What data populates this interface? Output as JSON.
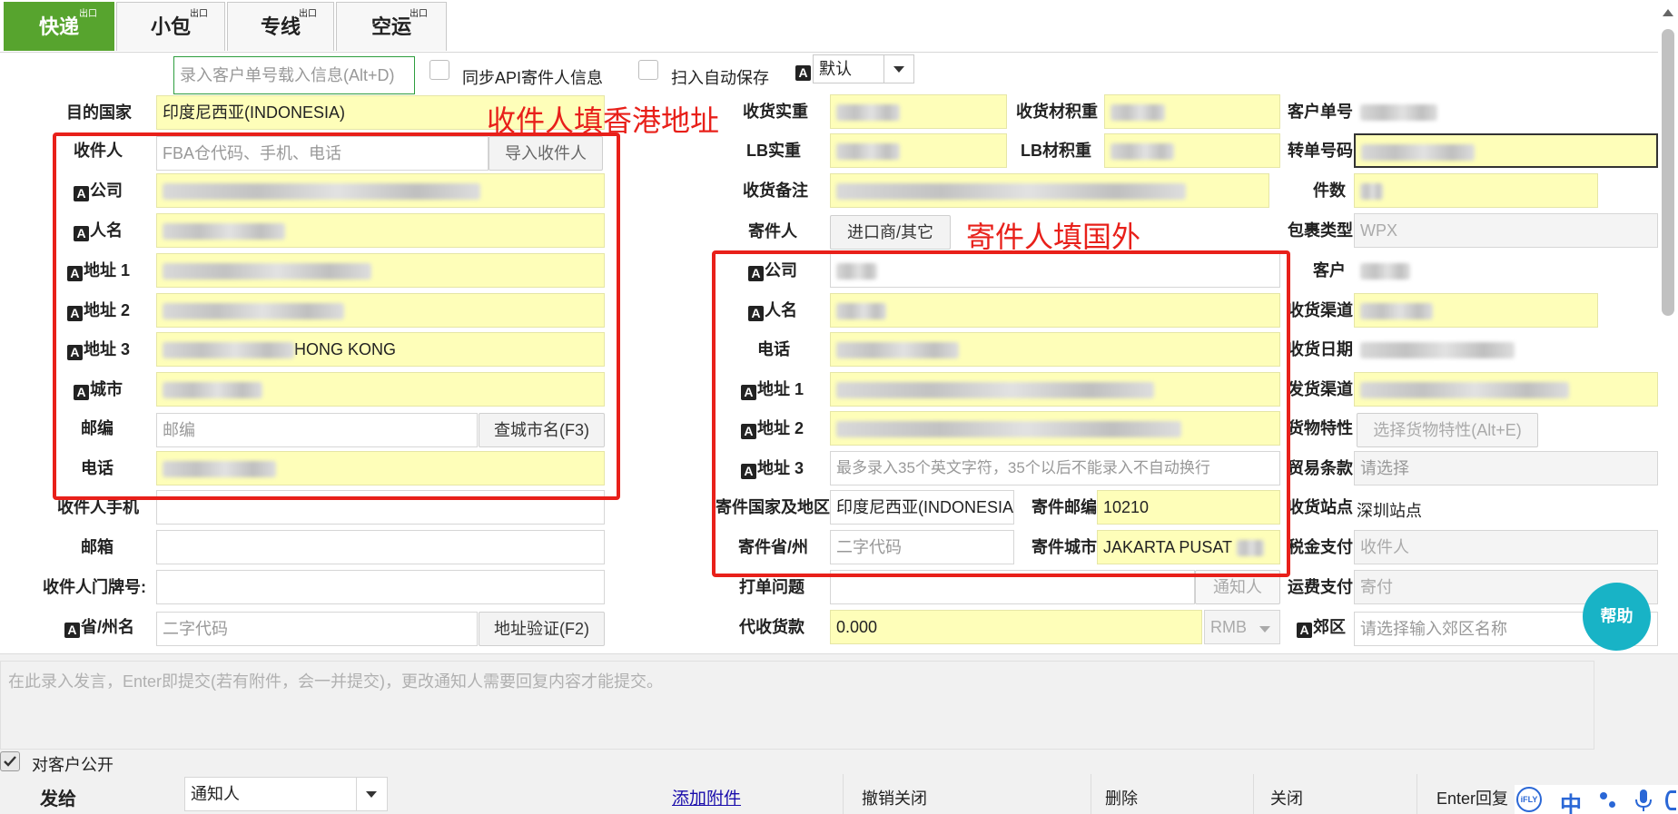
{
  "tabs": [
    {
      "label": "快递",
      "sup": "出口"
    },
    {
      "label": "小包",
      "sup": "出口"
    },
    {
      "label": "专线",
      "sup": "出口"
    },
    {
      "label": "空运",
      "sup": "出口"
    }
  ],
  "toolbar": {
    "load_placeholder": "录入客户单号载入信息(Alt+D)",
    "sync_api_label": "同步API寄件人信息",
    "auto_save_label": "扫入自动保存",
    "a_badge": "A",
    "template_value": "默认"
  },
  "annotations": {
    "recipient_note": "收件人填香港地址",
    "sender_note": "寄件人填国外"
  },
  "receiver": {
    "dest_country_label": "目的国家",
    "dest_country_value": "印度尼西亚(INDONESIA)",
    "recipient_label": "收件人",
    "recipient_placeholder": "FBA仓代码、手机、电话",
    "import_button": "导入收件人",
    "company_label": "公司",
    "name_label": "人名",
    "addr1_label": "地址 1",
    "addr2_label": "地址 2",
    "addr3_label": "地址 3",
    "addr3_value": "HONG KONG",
    "city_label": "城市",
    "postcode_label": "邮编",
    "postcode_placeholder": "邮编",
    "city_lookup_button": "查城市名(F3)",
    "phone_label": "电话",
    "mobile_label": "收件人手机",
    "email_label": "邮箱",
    "door_label": "收件人门牌号:",
    "province_label": "省/州名",
    "province_placeholder": "二字代码",
    "address_verify_button": "地址验证(F2)"
  },
  "middle": {
    "recv_weight_label": "收货实重",
    "recv_vol_label": "收货材积重",
    "lb_weight_label": "LB实重",
    "lb_vol_label": "LB材积重",
    "recv_note_label": "收货备注",
    "sender_label": "寄件人",
    "importer_button": "进口商/其它",
    "company_label": "公司",
    "name_label": "人名",
    "phone_label": "电话",
    "addr1_label": "地址 1",
    "addr2_label": "地址 2",
    "addr3_label": "地址 3",
    "addr3_placeholder": "最多录入35个英文字符，35个以后不能录入不自动换行",
    "sender_country_label": "寄件国家及地区",
    "sender_country_value": "印度尼西亚(INDONESIA)",
    "sender_postcode_label": "寄件邮编",
    "sender_postcode_value": "10210",
    "sender_province_label": "寄件省/州",
    "sender_province_placeholder": "二字代码",
    "sender_city_label": "寄件城市",
    "sender_city_value": "JAKARTA PUSAT",
    "print_issue_label": "打单问题",
    "notify_button": "通知人",
    "cod_label": "代收货款",
    "cod_value": "0.000",
    "currency": "RMB"
  },
  "right": {
    "customer_no_label": "客户单号",
    "transfer_no_label": "转单号码",
    "pieces_label": "件数",
    "package_type_label": "包裹类型",
    "package_type_value": "WPX",
    "customer_label": "客户",
    "recv_channel_label": "收货渠道",
    "recv_date_label": "收货日期",
    "ship_channel_label": "发货渠道",
    "goods_attr_label": "货物特性",
    "goods_attr_button": "选择货物特性(Alt+E)",
    "trade_terms_label": "贸易条款",
    "trade_terms_placeholder": "请选择",
    "recv_site_label": "收货站点",
    "recv_site_value": "深圳站点",
    "tax_pay_label": "税金支付",
    "tax_pay_placeholder": "收件人",
    "freight_pay_label": "运费支付",
    "freight_pay_placeholder": "寄付",
    "suburb_label": "郊区",
    "suburb_placeholder": "请选择输入郊区名称"
  },
  "help_button": "帮助",
  "comment": {
    "placeholder": "在此录入发言，Enter即提交(若有附件，会一并提交)，更改通知人需要回复内容才能提交。",
    "public_label": "对客户公开",
    "send_to_label": "发给",
    "send_to_value": "通知人",
    "add_attachment": "添加附件",
    "undo_close": "撤销关闭",
    "delete": "删除",
    "close": "关闭",
    "enter_reply": "Enter回复"
  },
  "ime": {
    "lang": "中"
  },
  "colors": {
    "accent_green": "#57a42e",
    "highlight_yellow": "#fefeb9",
    "annotation_red": "#e8201a",
    "help_teal": "#18b3c6",
    "link_blue": "#1a0dab"
  }
}
